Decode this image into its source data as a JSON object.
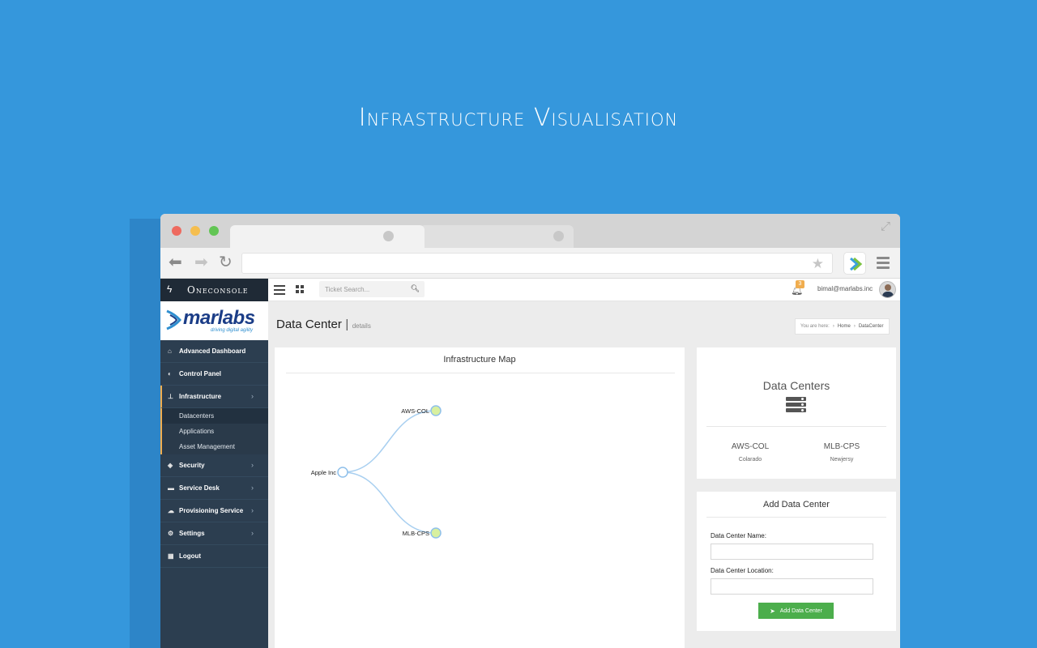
{
  "hero": {
    "title": "Infrastructure Visualisation"
  },
  "browser": {
    "back_icon": "arrow-left",
    "forward_icon": "arrow-right",
    "reload_icon": "reload",
    "bookmark_icon": "star",
    "menu_icon": "hamburger"
  },
  "app": {
    "brand": "Oneconsole",
    "logo": {
      "name": "marlabs",
      "tagline": "driving digital agility"
    },
    "search": {
      "placeholder": "Ticket Search..."
    },
    "notifications": {
      "count": "3"
    },
    "user": {
      "email": "bimal@marlabs.inc"
    }
  },
  "sidebar": {
    "items": [
      {
        "label": "Advanced Dashboard",
        "icon": "home-icon"
      },
      {
        "label": "Control Panel",
        "icon": "toggle-icon"
      },
      {
        "label": "Infrastructure",
        "icon": "sitemap-icon",
        "expanded": true,
        "children": [
          "Datacenters",
          "Applications",
          "Asset Management"
        ]
      },
      {
        "label": "Security",
        "icon": "shield-icon"
      },
      {
        "label": "Service Desk",
        "icon": "briefcase-icon"
      },
      {
        "label": "Provisioning Service",
        "icon": "cloud-icon"
      },
      {
        "label": "Settings",
        "icon": "cogs-icon"
      },
      {
        "label": "Logout",
        "icon": "calendar-icon"
      }
    ]
  },
  "page": {
    "title": "Data Center",
    "separator": "|",
    "subtitle": "details",
    "breadcrumb": {
      "prefix": "You are here:",
      "home": "Home",
      "current": "DataCenter",
      "separator": "›"
    }
  },
  "map": {
    "title": "Infrastructure Map",
    "root": "Apple Inc",
    "nodes": [
      "AWS-COL",
      "MLB-CPS"
    ]
  },
  "datacenters": {
    "title": "Data Centers",
    "items": [
      {
        "name": "AWS-COL",
        "location": "Colarado"
      },
      {
        "name": "MLB-CPS",
        "location": "Newjersy"
      }
    ]
  },
  "add_form": {
    "title": "Add Data Center",
    "name_label": "Data Center Name:",
    "name_value": "",
    "location_label": "Data Center Location:",
    "location_value": "",
    "button_label": "Add Data Center"
  },
  "colors": {
    "background": "#3597dc",
    "sidebar": "#2c3e50",
    "accent": "#f0ad4e",
    "button": "#4cae4c",
    "link_stroke": "#a8cff0",
    "leaf_fill": "#d8f0a0"
  }
}
